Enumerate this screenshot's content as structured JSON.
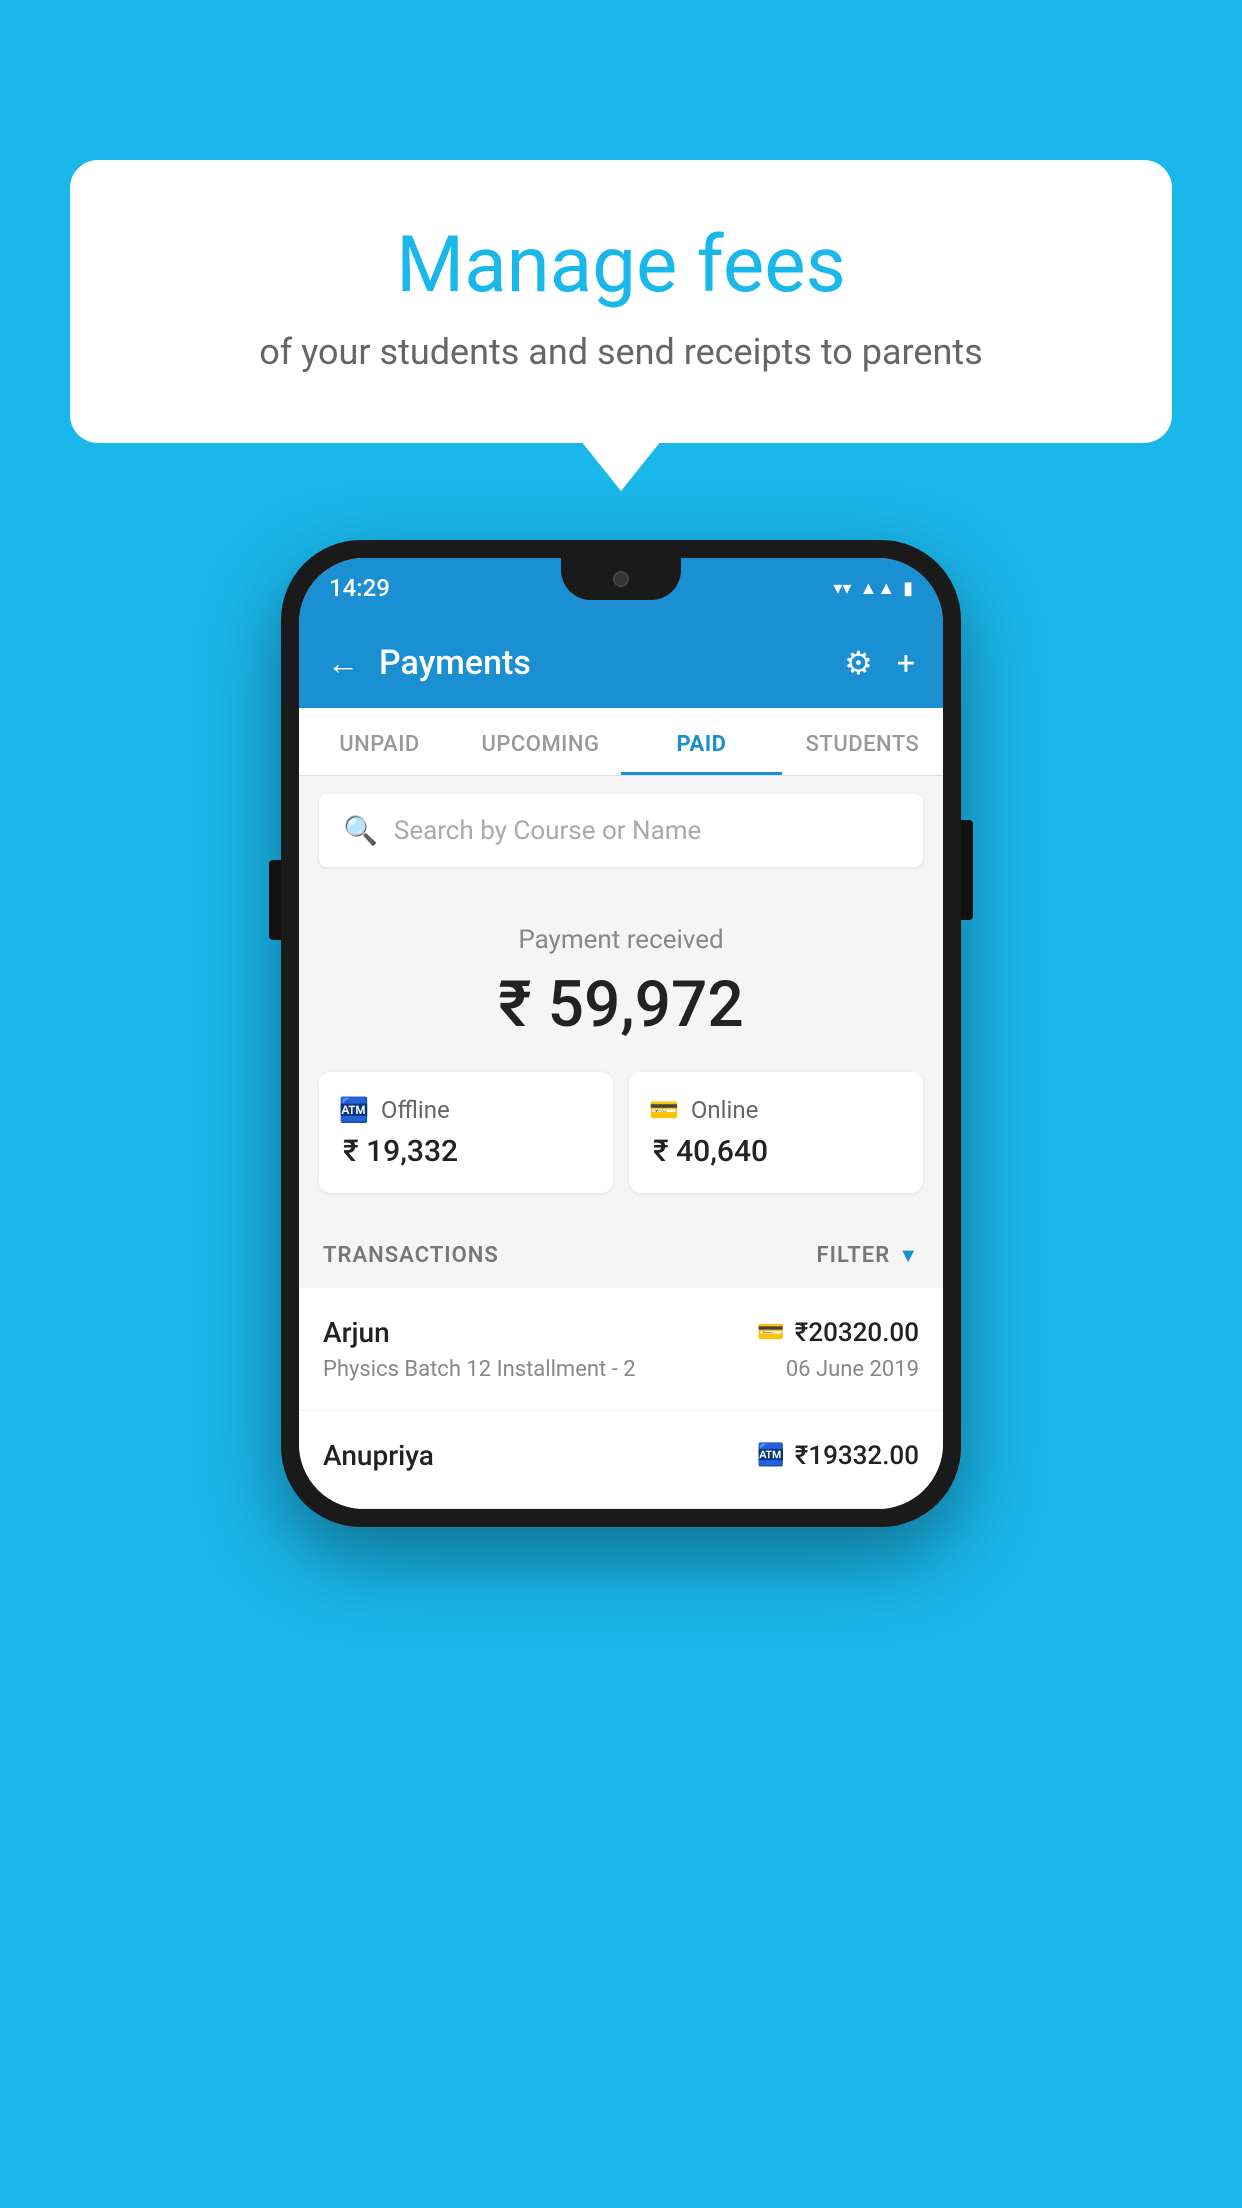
{
  "background_color": "#1ab7ea",
  "bubble": {
    "title": "Manage fees",
    "subtitle": "of your students and send receipts to parents"
  },
  "status_bar": {
    "time": "14:29",
    "wifi": "▼",
    "signal": "▲",
    "battery": "▮"
  },
  "header": {
    "back_label": "←",
    "title": "Payments",
    "gear_label": "⚙",
    "plus_label": "+"
  },
  "tabs": [
    {
      "id": "unpaid",
      "label": "UNPAID",
      "active": false
    },
    {
      "id": "upcoming",
      "label": "UPCOMING",
      "active": false
    },
    {
      "id": "paid",
      "label": "PAID",
      "active": true
    },
    {
      "id": "students",
      "label": "STUDENTS",
      "active": false
    }
  ],
  "search": {
    "placeholder": "Search by Course or Name"
  },
  "payment_summary": {
    "label": "Payment received",
    "amount": "₹ 59,972",
    "offline": {
      "type": "Offline",
      "amount": "₹ 19,332"
    },
    "online": {
      "type": "Online",
      "amount": "₹ 40,640"
    }
  },
  "transactions": {
    "label": "TRANSACTIONS",
    "filter_label": "FILTER",
    "items": [
      {
        "name": "Arjun",
        "course": "Physics Batch 12 Installment - 2",
        "amount": "₹20320.00",
        "date": "06 June 2019",
        "payment_type": "online"
      },
      {
        "name": "Anupriya",
        "course": "",
        "amount": "₹19332.00",
        "date": "",
        "payment_type": "offline"
      }
    ]
  }
}
